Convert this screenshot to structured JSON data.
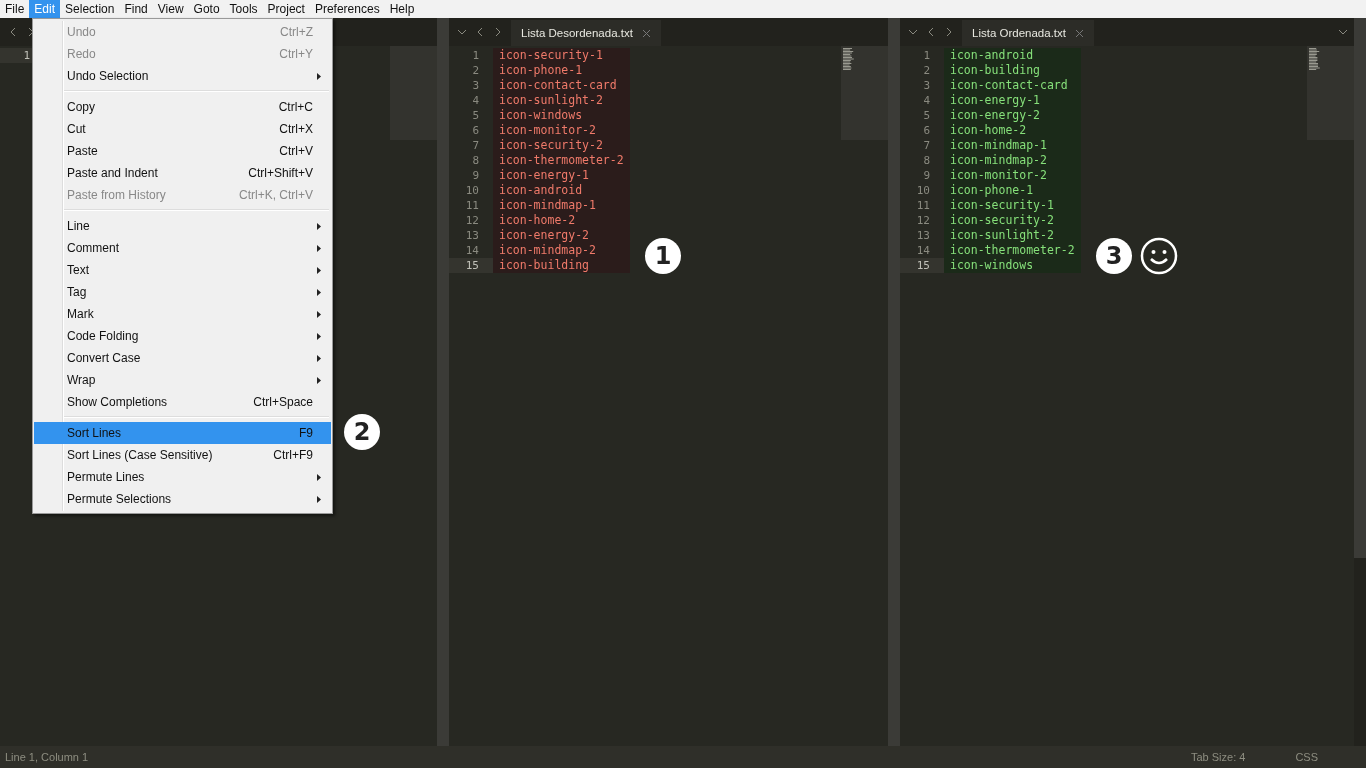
{
  "menubar": [
    {
      "label": "File",
      "selected": false
    },
    {
      "label": "Edit",
      "selected": true
    },
    {
      "label": "Selection",
      "selected": false
    },
    {
      "label": "Find",
      "selected": false
    },
    {
      "label": "View",
      "selected": false
    },
    {
      "label": "Goto",
      "selected": false
    },
    {
      "label": "Tools",
      "selected": false
    },
    {
      "label": "Project",
      "selected": false
    },
    {
      "label": "Preferences",
      "selected": false
    },
    {
      "label": "Help",
      "selected": false
    }
  ],
  "edit_menu": [
    {
      "kind": "item",
      "label": "Undo",
      "shortcut": "Ctrl+Z",
      "disabled": true,
      "submenu": false,
      "selected": false
    },
    {
      "kind": "item",
      "label": "Redo",
      "shortcut": "Ctrl+Y",
      "disabled": true,
      "submenu": false,
      "selected": false
    },
    {
      "kind": "item",
      "label": "Undo Selection",
      "disabled": false,
      "submenu": true,
      "selected": false
    },
    {
      "kind": "separator"
    },
    {
      "kind": "item",
      "label": "Copy",
      "shortcut": "Ctrl+C",
      "disabled": false,
      "submenu": false,
      "selected": false
    },
    {
      "kind": "item",
      "label": "Cut",
      "shortcut": "Ctrl+X",
      "disabled": false,
      "submenu": false,
      "selected": false
    },
    {
      "kind": "item",
      "label": "Paste",
      "shortcut": "Ctrl+V",
      "disabled": false,
      "submenu": false,
      "selected": false
    },
    {
      "kind": "item",
      "label": "Paste and Indent",
      "shortcut": "Ctrl+Shift+V",
      "disabled": false,
      "submenu": false,
      "selected": false
    },
    {
      "kind": "item",
      "label": "Paste from History",
      "shortcut": "Ctrl+K, Ctrl+V",
      "disabled": true,
      "submenu": false,
      "selected": false
    },
    {
      "kind": "separator"
    },
    {
      "kind": "item",
      "label": "Line",
      "disabled": false,
      "submenu": true,
      "selected": false
    },
    {
      "kind": "item",
      "label": "Comment",
      "disabled": false,
      "submenu": true,
      "selected": false
    },
    {
      "kind": "item",
      "label": "Text",
      "disabled": false,
      "submenu": true,
      "selected": false
    },
    {
      "kind": "item",
      "label": "Tag",
      "disabled": false,
      "submenu": true,
      "selected": false
    },
    {
      "kind": "item",
      "label": "Mark",
      "disabled": false,
      "submenu": true,
      "selected": false
    },
    {
      "kind": "item",
      "label": "Code Folding",
      "disabled": false,
      "submenu": true,
      "selected": false
    },
    {
      "kind": "item",
      "label": "Convert Case",
      "disabled": false,
      "submenu": true,
      "selected": false
    },
    {
      "kind": "item",
      "label": "Wrap",
      "disabled": false,
      "submenu": true,
      "selected": false
    },
    {
      "kind": "item",
      "label": "Show Completions",
      "shortcut": "Ctrl+Space",
      "disabled": false,
      "submenu": false,
      "selected": false
    },
    {
      "kind": "separator"
    },
    {
      "kind": "item",
      "label": "Sort Lines",
      "shortcut": "F9",
      "disabled": false,
      "submenu": false,
      "selected": true
    },
    {
      "kind": "item",
      "label": "Sort Lines (Case Sensitive)",
      "shortcut": "Ctrl+F9",
      "disabled": false,
      "submenu": false,
      "selected": false
    },
    {
      "kind": "item",
      "label": "Permute Lines",
      "disabled": false,
      "submenu": true,
      "selected": false
    },
    {
      "kind": "item",
      "label": "Permute Selections",
      "disabled": false,
      "submenu": true,
      "selected": false
    }
  ],
  "panes": [
    {
      "lines": [
        {
          "number": "1",
          "current": true
        }
      ]
    },
    {
      "tab": "Lista Desordenada.txt",
      "color": "#f07a6a",
      "lines": [
        {
          "number": "1",
          "text": "icon-security-1",
          "current": false
        },
        {
          "number": "2",
          "text": "icon-phone-1",
          "current": false
        },
        {
          "number": "3",
          "text": "icon-contact-card",
          "current": false
        },
        {
          "number": "4",
          "text": "icon-sunlight-2",
          "current": false
        },
        {
          "number": "5",
          "text": "icon-windows",
          "current": false
        },
        {
          "number": "6",
          "text": "icon-monitor-2",
          "current": false
        },
        {
          "number": "7",
          "text": "icon-security-2",
          "current": false
        },
        {
          "number": "8",
          "text": "icon-thermometer-2",
          "current": false
        },
        {
          "number": "9",
          "text": "icon-energy-1",
          "current": false
        },
        {
          "number": "10",
          "text": "icon-android",
          "current": false
        },
        {
          "number": "11",
          "text": "icon-mindmap-1",
          "current": false
        },
        {
          "number": "12",
          "text": "icon-home-2",
          "current": false
        },
        {
          "number": "13",
          "text": "icon-energy-2",
          "current": false
        },
        {
          "number": "14",
          "text": "icon-mindmap-2",
          "current": false
        },
        {
          "number": "15",
          "text": "icon-building",
          "current": true
        }
      ]
    },
    {
      "tab": "Lista Ordenada.txt",
      "color": "#86e07a",
      "lines": [
        {
          "number": "1",
          "text": "icon-android",
          "current": false
        },
        {
          "number": "2",
          "text": "icon-building",
          "current": false
        },
        {
          "number": "3",
          "text": "icon-contact-card",
          "current": false
        },
        {
          "number": "4",
          "text": "icon-energy-1",
          "current": false
        },
        {
          "number": "5",
          "text": "icon-energy-2",
          "current": false
        },
        {
          "number": "6",
          "text": "icon-home-2",
          "current": false
        },
        {
          "number": "7",
          "text": "icon-mindmap-1",
          "current": false
        },
        {
          "number": "8",
          "text": "icon-mindmap-2",
          "current": false
        },
        {
          "number": "9",
          "text": "icon-monitor-2",
          "current": false
        },
        {
          "number": "10",
          "text": "icon-phone-1",
          "current": false
        },
        {
          "number": "11",
          "text": "icon-security-1",
          "current": false
        },
        {
          "number": "12",
          "text": "icon-security-2",
          "current": false
        },
        {
          "number": "13",
          "text": "icon-sunlight-2",
          "current": false
        },
        {
          "number": "14",
          "text": "icon-thermometer-2",
          "current": false
        },
        {
          "number": "15",
          "text": "icon-windows",
          "current": true
        }
      ]
    }
  ],
  "callouts": [
    "1",
    "2",
    "3"
  ],
  "status_bar": {
    "position": "Line 1, Column 1",
    "tab_size": "Tab Size: 4",
    "syntax": "CSS"
  }
}
